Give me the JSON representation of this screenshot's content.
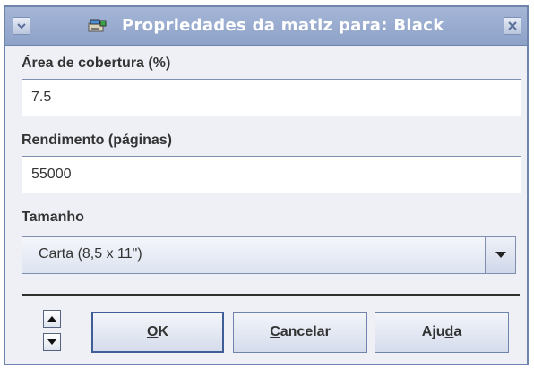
{
  "dialog": {
    "title": "Propriedades da matiz para: Black",
    "title_icon": "toner-cartridge-icon",
    "menu_icon": "chevron-down-icon",
    "close_icon": "close-icon"
  },
  "form": {
    "coverage": {
      "label": "Área de cobertura (%)",
      "value": "7.5"
    },
    "yield": {
      "label": "Rendimento (páginas)",
      "value": "55000"
    },
    "size": {
      "label": "Tamanho",
      "selected": "Carta (8,5 x 11\")"
    }
  },
  "buttons": {
    "ok": {
      "mnemonic": "O",
      "rest": "K"
    },
    "cancel": {
      "mnemonic": "C",
      "rest": "ancelar"
    },
    "help": {
      "before": "Aju",
      "mnemonic": "d",
      "after": "a"
    }
  },
  "colors": {
    "titlebar": "#8ea2c8",
    "window_bg": "#eef0f6",
    "border": "#6f84ad"
  }
}
